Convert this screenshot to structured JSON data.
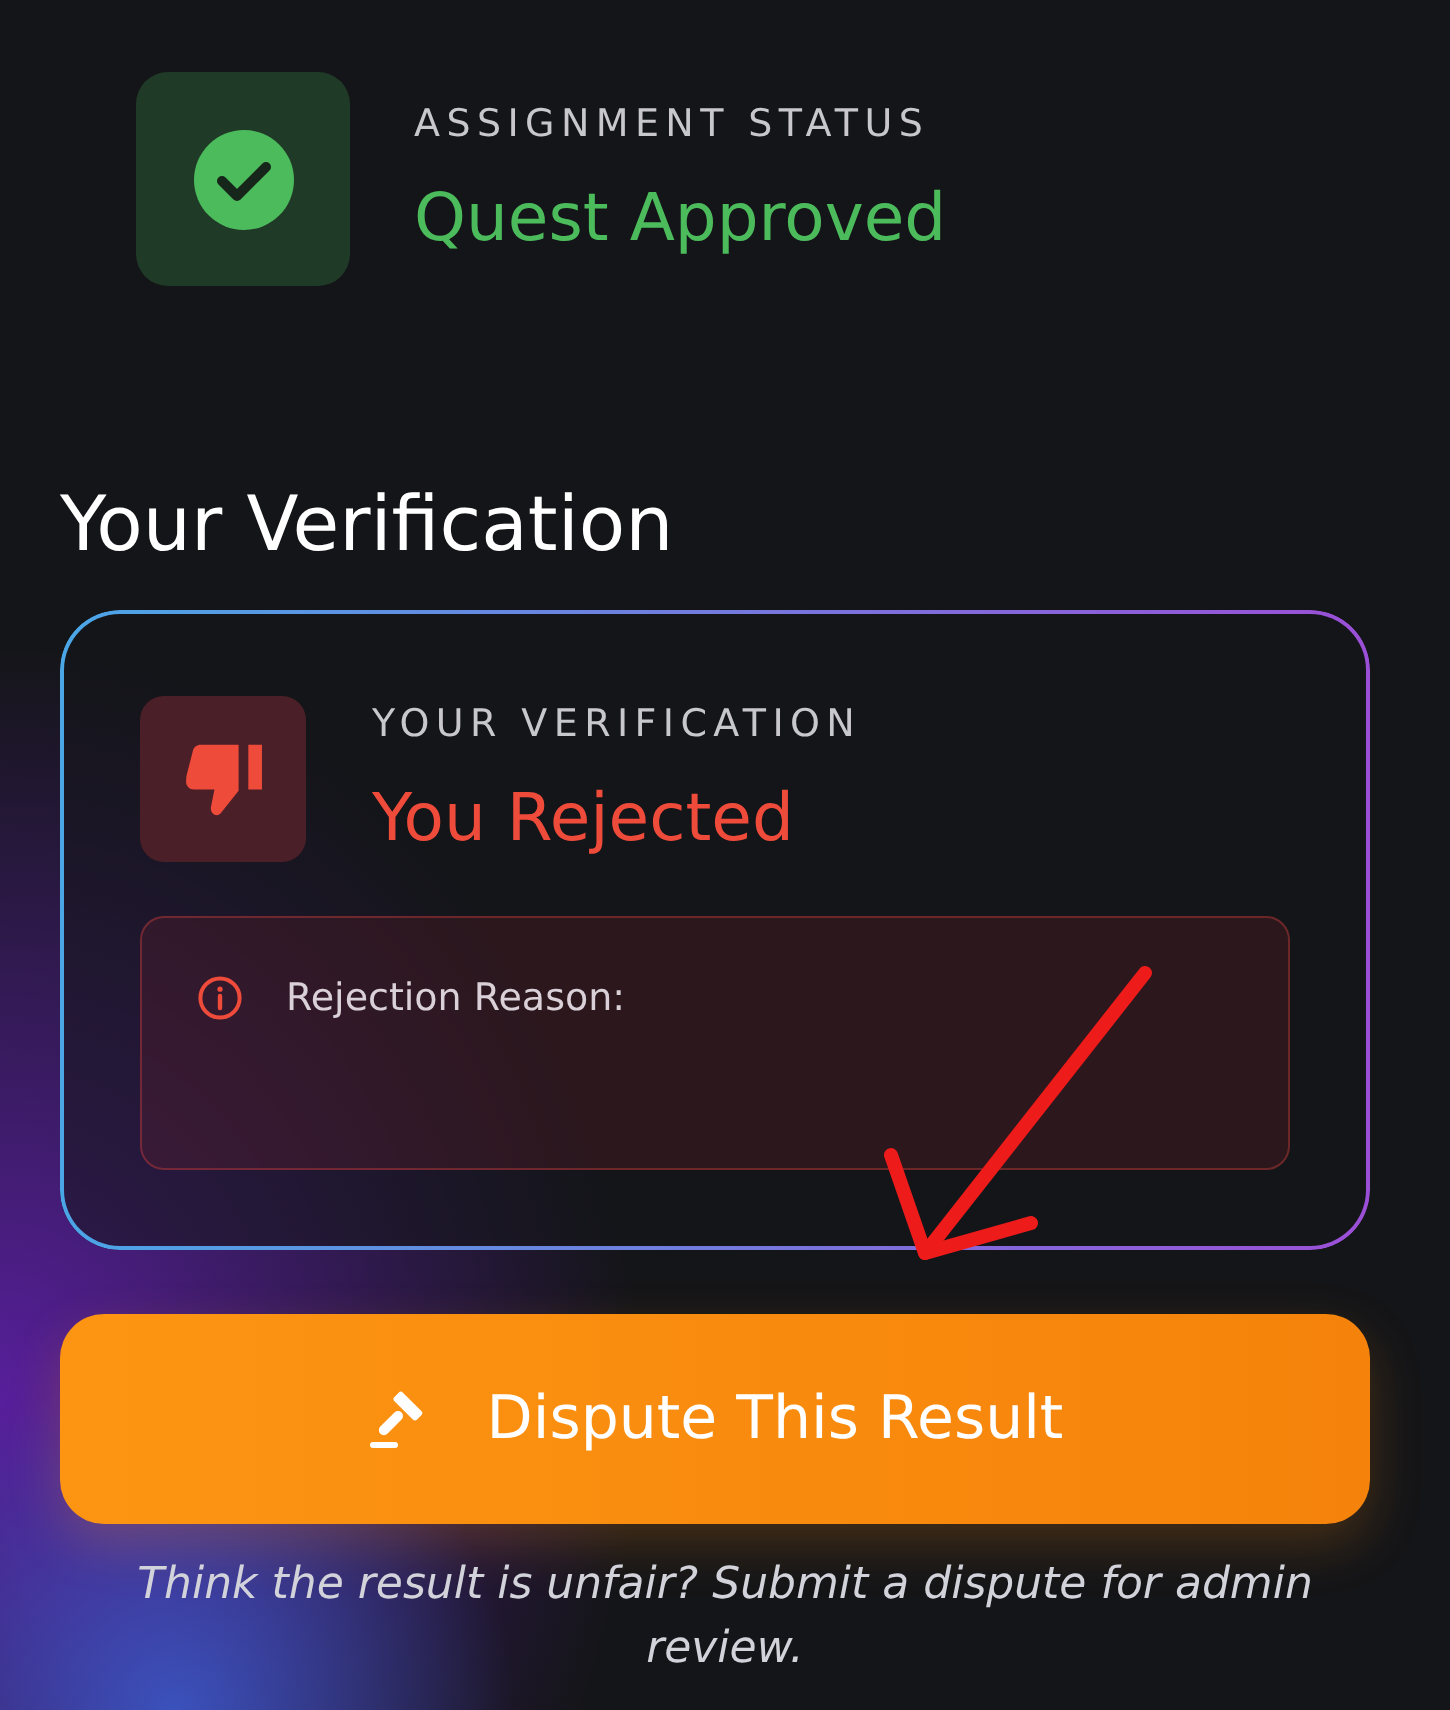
{
  "status": {
    "kind": "approved",
    "label": "ASSIGNMENT STATUS",
    "value": "Quest Approved"
  },
  "section_title": "Your Verification",
  "verification": {
    "kind": "rejected",
    "label": "YOUR VERIFICATION",
    "value": "You Rejected",
    "reason": {
      "label": "Rejection Reason:"
    }
  },
  "dispute_button": {
    "label": "Dispute This Result"
  },
  "helper_text": "Think the result is unfair? Submit a dispute for admin review."
}
